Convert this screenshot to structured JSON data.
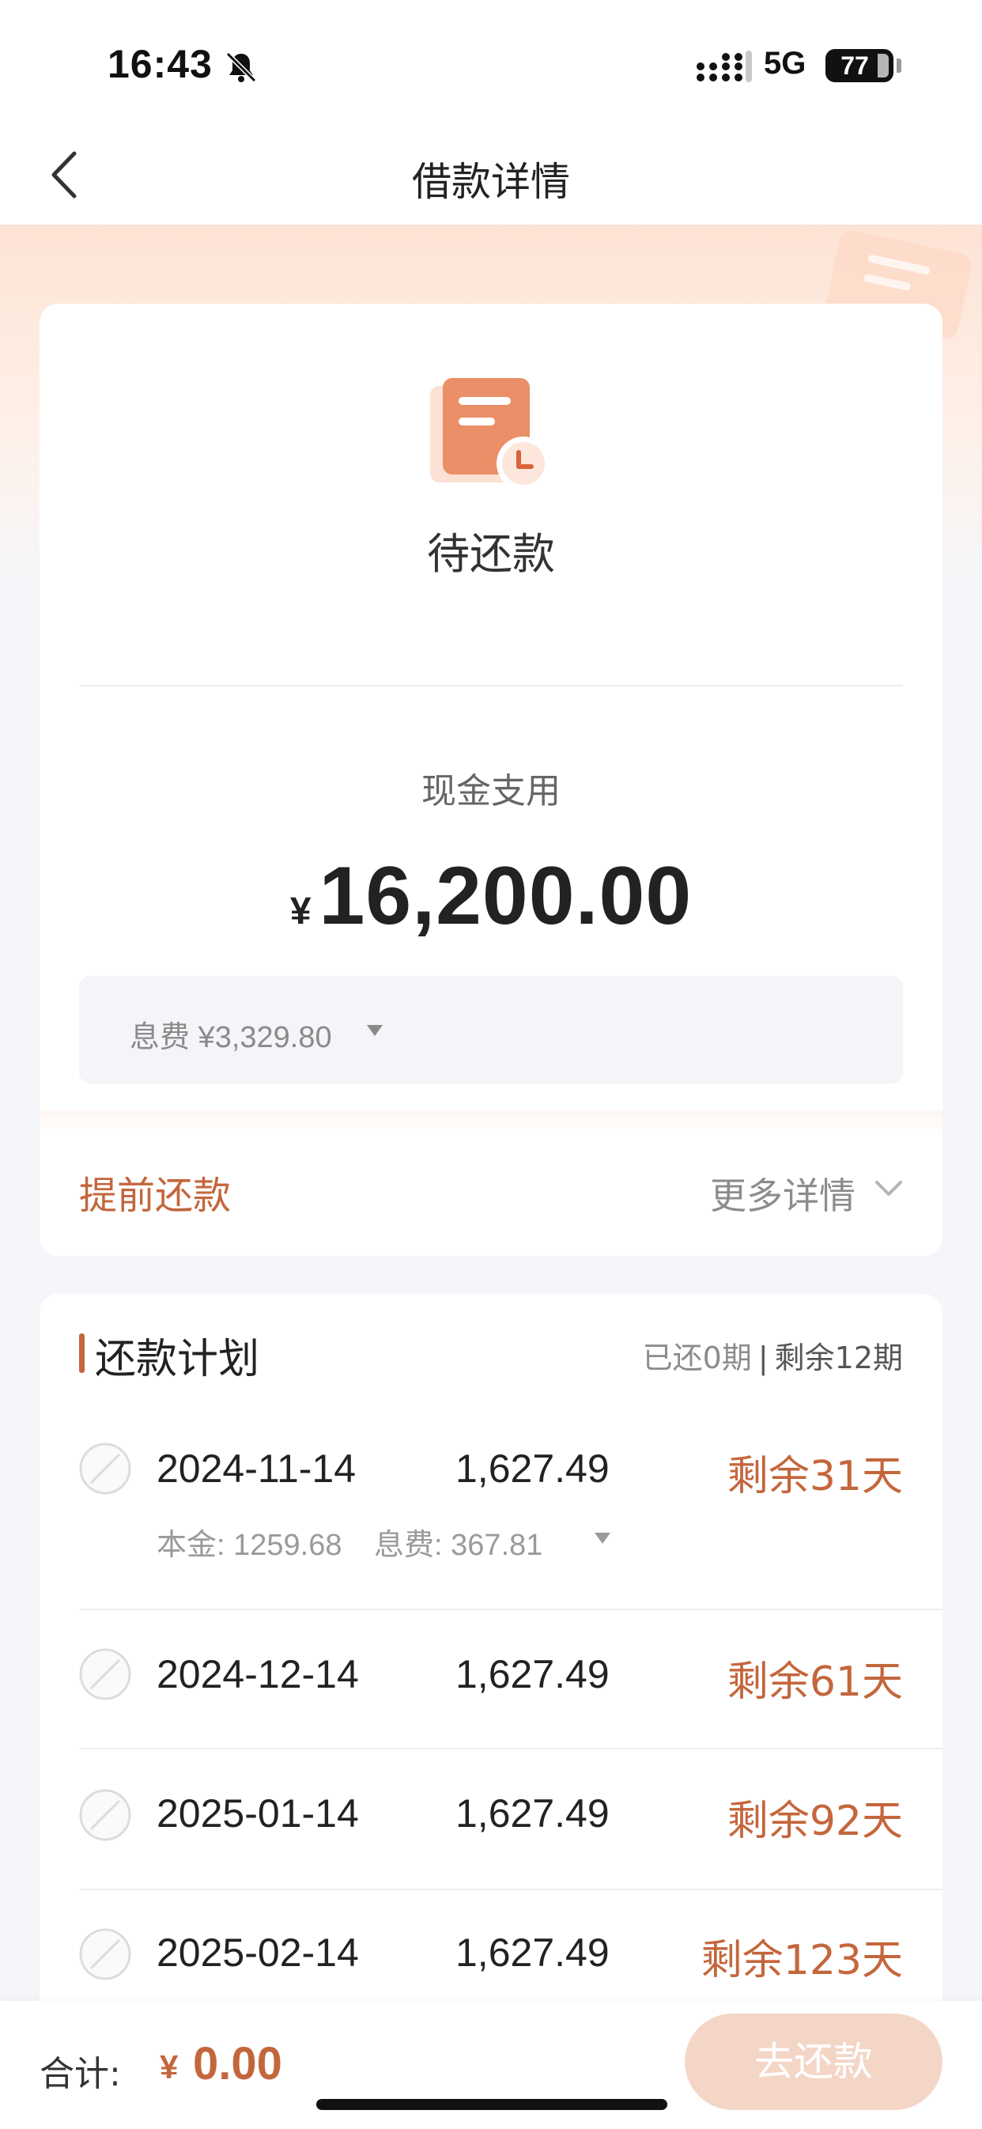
{
  "status_bar": {
    "time": "16:43",
    "network": "5G",
    "battery": "77"
  },
  "nav": {
    "title": "借款详情"
  },
  "loan_card": {
    "status": "待还款",
    "usage_label": "现金支用",
    "currency_symbol": "¥",
    "amount": "16,200.00",
    "fee_text": "息费 ¥3,329.80",
    "prepay_label": "提前还款",
    "more_label": "更多详情"
  },
  "plan": {
    "title": "还款计划",
    "paid_text": "已还0期",
    "separator": "|",
    "remaining_text": "剩余12期",
    "installments": [
      {
        "date": "2024-11-14",
        "amount": "1,627.49",
        "remain": "剩余31天",
        "principal": "本金: 1259.68",
        "interest": "息费: 367.81",
        "expanded": true
      },
      {
        "date": "2024-12-14",
        "amount": "1,627.49",
        "remain": "剩余61天"
      },
      {
        "date": "2025-01-14",
        "amount": "1,627.49",
        "remain": "剩余92天"
      },
      {
        "date": "2025-02-14",
        "amount": "1,627.49",
        "remain": "剩余123天"
      }
    ]
  },
  "bottom_bar": {
    "total_label": "合计:",
    "currency_symbol": "¥",
    "total_value": "0.00",
    "repay_button": "去还款"
  },
  "colors": {
    "accent": "#c4663c",
    "button_disabled": "#f4d6c7",
    "page_bg": "#f5f6fa"
  },
  "icons": {
    "back": "back-icon",
    "bell": "bell-slash-icon",
    "signal": "signal-icon",
    "document": "document-clock-icon",
    "fee_toggle": "triangle-down-icon",
    "more": "chevron-down-icon",
    "installment_check": "circle-check-icon"
  }
}
